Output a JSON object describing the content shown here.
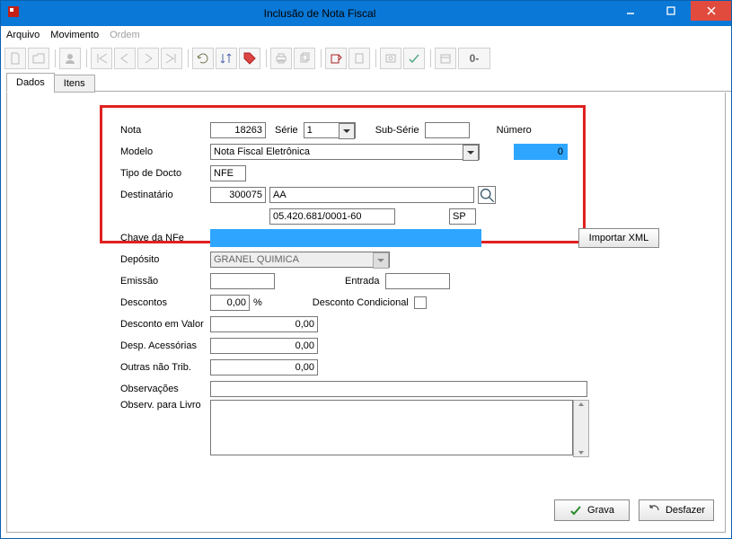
{
  "window": {
    "title": "Inclusão de Nota Fiscal"
  },
  "menu": {
    "arquivo": "Arquivo",
    "movimento": "Movimento",
    "ordem": "Ordem"
  },
  "toolbar": {
    "zero": "0-"
  },
  "tabs": [
    "Dados",
    "Itens"
  ],
  "labels": {
    "nota": "Nota",
    "serie": "Série",
    "subserie": "Sub-Série",
    "numero": "Número",
    "modelo": "Modelo",
    "tipo_docto": "Tipo de Docto",
    "destinatario": "Destinatário",
    "chave_nfe": "Chave da NFe",
    "importar_xml": "Importar XML",
    "deposito": "Depósito",
    "emissao": "Emissão",
    "entrada": "Entrada",
    "descontos": "Descontos",
    "percent": "%",
    "desconto_condicional": "Desconto Condicional",
    "desconto_valor": "Desconto em Valor",
    "desp_acessorias": "Desp. Acessórias",
    "outras_trib": "Outras não Trib.",
    "observacoes": "Observações",
    "observ_livro": "Observ. para Livro",
    "grava": "Grava",
    "desfazer": "Desfazer"
  },
  "fields": {
    "nota": "18263",
    "serie": "1",
    "subserie": "",
    "numero": "0",
    "modelo": "Nota Fiscal Eletrônica",
    "tipo_docto": "NFE",
    "dest_codigo": "300075",
    "dest_nome": "AA",
    "dest_cnpj": "05.420.681/0001-60",
    "dest_uf": "SP",
    "chave_nfe": "",
    "deposito": "GRANEL QUIMICA",
    "emissao": "",
    "entrada": "",
    "descontos": "0,00",
    "desconto_condicional": false,
    "desconto_valor": "0,00",
    "desp_acessorias": "0,00",
    "outras_trib": "0,00",
    "observacoes": "",
    "observ_livro": ""
  }
}
